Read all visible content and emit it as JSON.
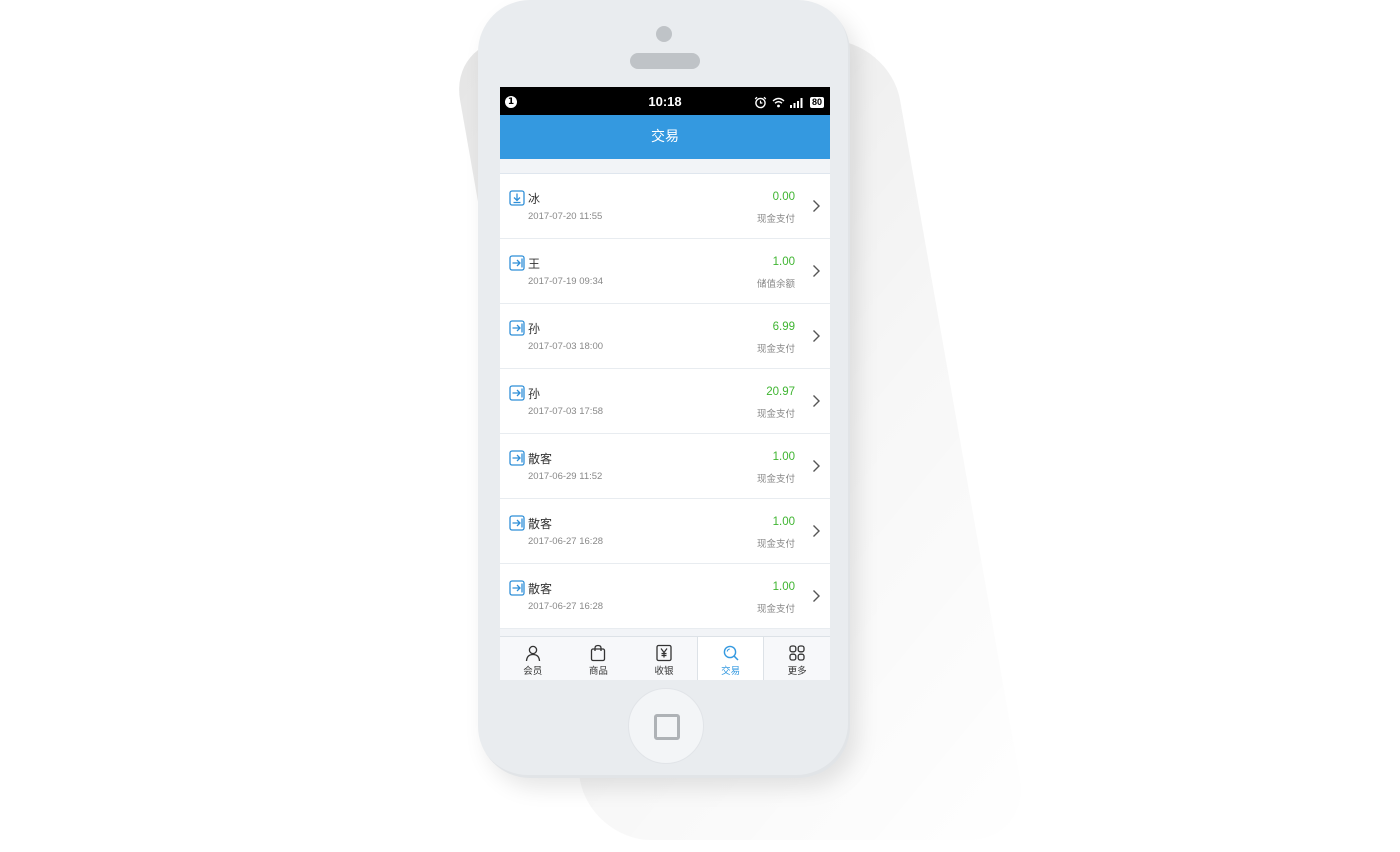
{
  "status_bar": {
    "notification_count": "1",
    "time": "10:18",
    "battery": "80"
  },
  "header": {
    "title": "交易"
  },
  "transactions": [
    {
      "name": "冰",
      "date": "2017-07-20 11:55",
      "amount": "0.00",
      "method": "现金支付",
      "icon": "download-in-icon"
    },
    {
      "name": "王",
      "date": "2017-07-19 09:34",
      "amount": "1.00",
      "method": "储值余额",
      "icon": "arrow-in-icon"
    },
    {
      "name": "孙",
      "date": "2017-07-03 18:00",
      "amount": "6.99",
      "method": "现金支付",
      "icon": "arrow-in-icon"
    },
    {
      "name": "孙",
      "date": "2017-07-03 17:58",
      "amount": "20.97",
      "method": "现金支付",
      "icon": "arrow-in-icon"
    },
    {
      "name": "散客",
      "date": "2017-06-29 11:52",
      "amount": "1.00",
      "method": "现金支付",
      "icon": "arrow-in-icon"
    },
    {
      "name": "散客",
      "date": "2017-06-27 16:28",
      "amount": "1.00",
      "method": "现金支付",
      "icon": "arrow-in-icon"
    },
    {
      "name": "散客",
      "date": "2017-06-27 16:28",
      "amount": "1.00",
      "method": "现金支付",
      "icon": "arrow-in-icon"
    }
  ],
  "tabbar": {
    "items": [
      {
        "label": "会员",
        "icon": "person-icon"
      },
      {
        "label": "商品",
        "icon": "bag-icon"
      },
      {
        "label": "收银",
        "icon": "yen-register-icon"
      },
      {
        "label": "交易",
        "icon": "search-icon",
        "active": true
      },
      {
        "label": "更多",
        "icon": "grid-icon"
      }
    ]
  },
  "colors": {
    "accent": "#3499e0",
    "amount_green": "#3fb531"
  }
}
